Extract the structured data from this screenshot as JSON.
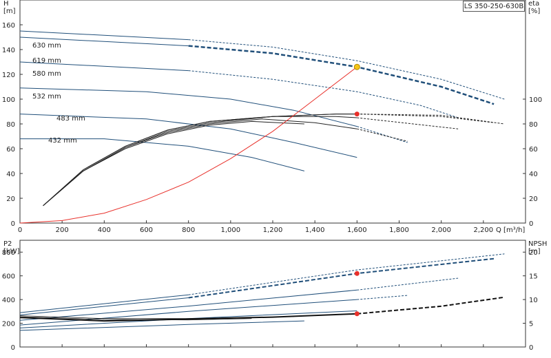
{
  "model_label": "LS 350-250-630B",
  "chart_data": [
    {
      "type": "line",
      "panel": "head-efficiency",
      "xlabel": "Q [m³/h]",
      "ylabel_left": "H\n[m]",
      "ylabel_right": "eta\n[%]",
      "xlim": [
        0,
        2400
      ],
      "ylim_left": [
        0,
        180
      ],
      "ylim_right": [
        0,
        180
      ],
      "x_ticks": [
        0,
        200,
        400,
        600,
        800,
        1000,
        1200,
        1400,
        1600,
        1800,
        2000,
        2200
      ],
      "x_tick_labels": [
        "0",
        "200",
        "400",
        "600",
        "800",
        "1,000",
        "1,200",
        "1,400",
        "1,600",
        "1,800",
        "2,000",
        "2,200"
      ],
      "y_ticks_left": [
        0,
        20,
        40,
        60,
        80,
        100,
        120,
        140,
        160
      ],
      "y_ticks_right": [
        0,
        20,
        40,
        60,
        80,
        100
      ],
      "grid": false,
      "head_curves": [
        {
          "name": "630 mm",
          "solid": [
            [
              0,
              155
            ],
            [
              800,
              148
            ]
          ],
          "dashed": [
            [
              800,
              148
            ],
            [
              1200,
              142
            ],
            [
              1600,
              131
            ],
            [
              2000,
              116
            ],
            [
              2300,
              100
            ]
          ]
        },
        {
          "name": "619 mm",
          "solid": [
            [
              0,
              150
            ],
            [
              800,
              143
            ]
          ],
          "dashed": [
            [
              800,
              143
            ],
            [
              1200,
              137
            ],
            [
              1600,
              126
            ],
            [
              2000,
              110
            ],
            [
              2250,
              96
            ]
          ]
        },
        {
          "name": "580 mm",
          "solid": [
            [
              0,
              130
            ],
            [
              800,
              123
            ]
          ],
          "dashed": [
            [
              800,
              123
            ],
            [
              1200,
              116
            ],
            [
              1600,
              106
            ],
            [
              1900,
              95
            ],
            [
              2080,
              85
            ]
          ]
        },
        {
          "name": "532 mm",
          "solid": [
            [
              0,
              109
            ],
            [
              600,
              106
            ],
            [
              1000,
              100
            ],
            [
              1300,
              91
            ],
            [
              1600,
              78
            ]
          ],
          "dashed": [
            [
              1600,
              78
            ],
            [
              1840,
              65
            ]
          ]
        },
        {
          "name": "483 mm",
          "solid": [
            [
              0,
              88
            ],
            [
              600,
              84
            ],
            [
              1000,
              76
            ],
            [
              1300,
              65
            ],
            [
              1600,
              53
            ]
          ],
          "dashed": []
        },
        {
          "name": "432 mm",
          "solid": [
            [
              0,
              68
            ],
            [
              400,
              68
            ],
            [
              800,
              62
            ],
            [
              1100,
              53
            ],
            [
              1350,
              42
            ]
          ],
          "dashed": []
        }
      ],
      "efficiency_curves": [
        {
          "solid": [
            [
              110,
              14
            ],
            [
              300,
              42
            ],
            [
              500,
              60
            ],
            [
              700,
              72
            ],
            [
              900,
              79
            ],
            [
              1100,
              82
            ],
            [
              1350,
              80
            ]
          ],
          "dashed": []
        },
        {
          "solid": [
            [
              110,
              14
            ],
            [
              300,
              42
            ],
            [
              500,
              61
            ],
            [
              700,
              73
            ],
            [
              900,
              80
            ],
            [
              1150,
              84
            ],
            [
              1400,
              81
            ],
            [
              1600,
              76
            ]
          ],
          "dashed": [
            [
              1600,
              76
            ],
            [
              1840,
              66
            ]
          ]
        },
        {
          "solid": [
            [
              110,
              14
            ],
            [
              300,
              42
            ],
            [
              500,
              61
            ],
            [
              700,
              74
            ],
            [
              900,
              81
            ],
            [
              1200,
              86
            ],
            [
              1500,
              86
            ],
            [
              1600,
              85
            ]
          ],
          "dashed": [
            [
              1600,
              85
            ],
            [
              2080,
              76
            ]
          ]
        },
        {
          "solid": [
            [
              110,
              14
            ],
            [
              300,
              43
            ],
            [
              500,
              62
            ],
            [
              700,
              75
            ],
            [
              900,
              82
            ],
            [
              1200,
              86
            ],
            [
              1500,
              88
            ],
            [
              1600,
              88
            ]
          ],
          "dashed": [
            [
              1600,
              88
            ],
            [
              2000,
              86
            ],
            [
              2250,
              81
            ]
          ]
        },
        {
          "solid": [
            [
              110,
              14
            ],
            [
              300,
              43
            ],
            [
              500,
              62
            ],
            [
              700,
              75
            ],
            [
              900,
              82
            ],
            [
              1200,
              86
            ],
            [
              1500,
              88
            ],
            [
              1600,
              88
            ]
          ],
          "dashed": [
            [
              1600,
              88
            ],
            [
              2000,
              87
            ],
            [
              2300,
              80
            ]
          ]
        }
      ],
      "system_curve": [
        [
          0,
          0
        ],
        [
          200,
          2
        ],
        [
          400,
          8
        ],
        [
          600,
          19
        ],
        [
          800,
          33
        ],
        [
          1000,
          52
        ],
        [
          1200,
          74
        ],
        [
          1400,
          100
        ],
        [
          1600,
          126
        ]
      ],
      "duty_point": {
        "q": 1600,
        "h": 126
      },
      "efficiency_point": {
        "q": 1600,
        "eta": 88
      }
    },
    {
      "type": "line",
      "panel": "power-npsh",
      "ylabel_left": "P2\n[kW]",
      "ylabel_right": "NPSH\n[m]",
      "xlim": [
        0,
        2400
      ],
      "ylim_left": [
        0,
        900
      ],
      "ylim_right": [
        0,
        22.5
      ],
      "y_ticks_left": [
        0,
        200,
        400,
        600,
        800
      ],
      "y_ticks_right": [
        0,
        5,
        10,
        15,
        20
      ],
      "power_curves": [
        {
          "name": "630 mm",
          "solid": [
            [
              0,
              290
            ],
            [
              800,
              440
            ]
          ],
          "dashed": [
            [
              800,
              440
            ],
            [
              1600,
              650
            ],
            [
              2300,
              785
            ]
          ]
        },
        {
          "name": "619 mm",
          "solid": [
            [
              0,
              270
            ],
            [
              800,
              415
            ]
          ],
          "dashed": [
            [
              800,
              415
            ],
            [
              1600,
              620
            ],
            [
              2250,
              745
            ]
          ]
        },
        {
          "name": "580 mm",
          "solid": [
            [
              0,
              225
            ],
            [
              800,
              345
            ],
            [
              1600,
              480
            ]
          ],
          "dashed": [
            [
              1600,
              480
            ],
            [
              2080,
              580
            ]
          ]
        },
        {
          "name": "532 mm",
          "solid": [
            [
              0,
              185
            ],
            [
              800,
              300
            ],
            [
              1600,
              400
            ]
          ],
          "dashed": [
            [
              1600,
              400
            ],
            [
              1840,
              435
            ]
          ]
        },
        {
          "name": "483 mm",
          "solid": [
            [
              0,
              160
            ],
            [
              800,
              240
            ],
            [
              1600,
              305
            ]
          ],
          "dashed": []
        },
        {
          "name": "432 mm",
          "solid": [
            [
              0,
              140
            ],
            [
              800,
              190
            ],
            [
              1350,
              220
            ]
          ],
          "dashed": []
        }
      ],
      "npsh_curve": {
        "solid": [
          [
            0,
            6.2
          ],
          [
            400,
            5.5
          ],
          [
            800,
            5.9
          ],
          [
            1200,
            6.3
          ],
          [
            1600,
            7.0
          ]
        ],
        "dashed": [
          [
            1600,
            7.0
          ],
          [
            2000,
            8.6
          ],
          [
            2300,
            10.5
          ]
        ]
      },
      "npsh_light_curves": [
        {
          "solid": [
            [
              0,
              6.4
            ],
            [
              400,
              5.8
            ],
            [
              800,
              5.7
            ],
            [
              1100,
              6.0
            ]
          ],
          "dashed": []
        },
        {
          "solid": [
            [
              0,
              6.6
            ],
            [
              400,
              6.0
            ],
            [
              800,
              6.0
            ],
            [
              1300,
              6.4
            ]
          ],
          "dashed": []
        }
      ],
      "power_point": {
        "q": 1600,
        "p2": 620
      },
      "npsh_point": {
        "q": 1600,
        "npsh": 7.0
      }
    }
  ]
}
